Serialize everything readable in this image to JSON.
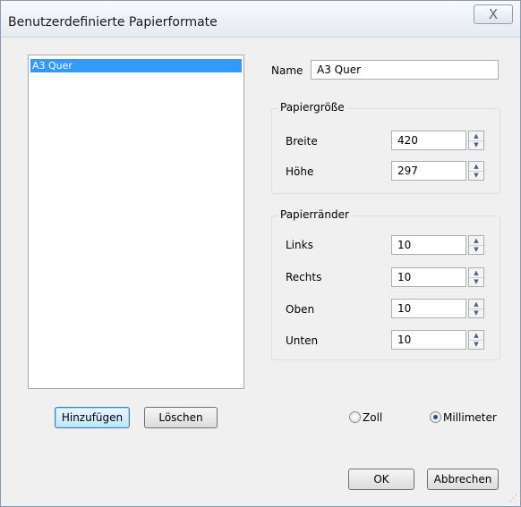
{
  "window": {
    "title": "Benutzerdefinierte Papierformate",
    "close_glyph": "X"
  },
  "list": {
    "items": [
      {
        "label": "A3 Quer",
        "selected": true
      }
    ]
  },
  "buttons": {
    "add": "Hinzufügen",
    "delete": "Löschen",
    "ok": "OK",
    "cancel": "Abbrechen"
  },
  "name_field": {
    "label": "Name",
    "value": "A3 Quer"
  },
  "paper_size": {
    "title": "Papiergröße",
    "width": {
      "label": "Breite",
      "value": "420"
    },
    "height": {
      "label": "Höhe",
      "value": "297"
    }
  },
  "margins": {
    "title": "Papierränder",
    "left": {
      "label": "Links",
      "value": "10"
    },
    "right": {
      "label": "Rechts",
      "value": "10"
    },
    "top": {
      "label": "Oben",
      "value": "10"
    },
    "bottom": {
      "label": "Unten",
      "value": "10"
    }
  },
  "units": {
    "inch": {
      "label": "Zoll",
      "checked": false
    },
    "mm": {
      "label": "Millimeter",
      "checked": true
    }
  },
  "icons": {
    "spin_up": "▲",
    "spin_down": "▼",
    "resize_grip": "⋰"
  },
  "colors": {
    "selection": "#3399ff",
    "window_bg": "#f0f0f0"
  }
}
